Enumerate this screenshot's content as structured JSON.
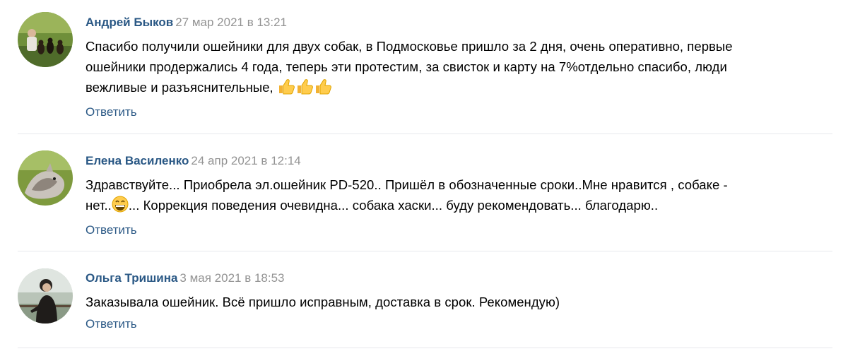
{
  "comments": [
    {
      "author": "Андрей Быков",
      "date": "27 мар 2021 в 13:21",
      "text_line1": "Спасибо получили ошейники для двух собак, в Подмосковье пришло за 2 дня, очень оперативно, первые",
      "text_line2": "ошейники продержались 4 года, теперь эти протестим, за свисток и карту на 7%отдельно спасибо, люди",
      "text_line3": "вежливые и разъяснительные,",
      "emojis": [
        "thumbs-up-icon",
        "thumbs-up-icon",
        "thumbs-up-icon"
      ],
      "reply_label": "Ответить"
    },
    {
      "author": "Елена Василенко",
      "date": "24 апр 2021 в 12:14",
      "text_line1": "Здравствуйте... Приобрела эл.ошейник PD-520.. Пришёл в обозначенные сроки..Мне нравится , собаке -",
      "text_line2_before": "нет..",
      "emoji": "grinning-face-icon",
      "text_line2_after": "... Коррекция поведения очевидна... собака хаски... буду рекомендовать... благодарю..",
      "reply_label": "Ответить"
    },
    {
      "author": "Ольга Тришина",
      "date": "3 мая 2021 в 18:53",
      "text_line1": "Заказывала ошейник. Всё пришло исправным, доставка в срок. Рекомендую)",
      "reply_label": "Ответить"
    }
  ],
  "colors": {
    "link": "#2a5885",
    "date": "#939393",
    "text": "#000000",
    "divider": "#e7e8ec"
  }
}
